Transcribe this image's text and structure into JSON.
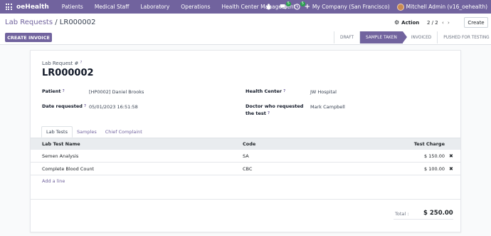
{
  "navbar": {
    "brand": "oeHealth",
    "menu": [
      "Patients",
      "Medical Staff",
      "Laboratory",
      "Operations",
      "Health Center Management"
    ],
    "chat_badge": "5",
    "activity_badge": "5",
    "company": "My Company (San Francisco)",
    "user": "Mitchell Admin (v16_oehealth)"
  },
  "control": {
    "breadcrumb_parent": "Lab Requests",
    "breadcrumb_sep": " / ",
    "breadcrumb_current": "LR000002",
    "action_label": "Action",
    "pager": "2 / 2",
    "create_label": "Create",
    "create_invoice_label": "CREATE INVOICE",
    "stages": [
      "DRAFT",
      "SAMPLE TAKEN",
      "INVOICED",
      "PUSHED FOR TESTING"
    ],
    "active_stage": "SAMPLE TAKEN"
  },
  "form": {
    "ref_label": "Lab Request #",
    "ref_value": "LR000002",
    "patient_label": "Patient",
    "patient_value": "[HP0002] Daniel Brooks",
    "date_label": "Date requested",
    "date_value": "05/01/2023 16:51:58",
    "center_label": "Health Center",
    "center_value": "JW Hospital",
    "doctor_label_1": "Doctor who requested",
    "doctor_label_2": "the test",
    "doctor_value": "Mark Campbell",
    "required_mark": "?"
  },
  "tabs": [
    "Lab Tests",
    "Samples",
    "Chief Complaint"
  ],
  "table": {
    "headers": {
      "name": "Lab Test Name",
      "code": "Code",
      "charge": "Test Charge"
    },
    "rows": [
      {
        "name": "Semen Analysis",
        "code": "SA",
        "charge": "$ 150.00"
      },
      {
        "name": "Complete Blood Count",
        "code": "CBC",
        "charge": "$ 100.00"
      }
    ],
    "add_line": "Add a line"
  },
  "totals": {
    "label": "Total :",
    "value": "$ 250.00"
  },
  "colors": {
    "brand": "#71639e",
    "badge": "#2aa24e"
  }
}
